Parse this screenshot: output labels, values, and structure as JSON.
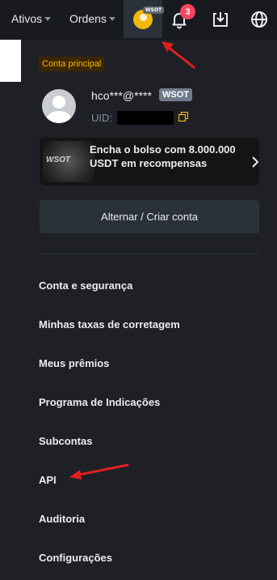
{
  "topnav": {
    "assets_label": "Ativos",
    "orders_label": "Ordens",
    "avatar_badge": "WSOT",
    "notification_count": "3"
  },
  "account": {
    "label": "Conta principal",
    "email": "hco***@****",
    "tag": "WSOT",
    "uid_label": "UID:"
  },
  "promo": {
    "logo_text": "WSOT",
    "text": "Encha o bolso com 8.000.000 USDT em recompensas"
  },
  "switch_button": "Alternar / Criar conta",
  "menu": [
    "Conta e segurança",
    "Minhas taxas de corretagem",
    "Meus prêmios",
    "Programa de Indicações",
    "Subcontas",
    "API",
    "Auditoria",
    "Configurações"
  ],
  "colors": {
    "accent": "#f0b90b",
    "annotation_arrow": "#e0201b",
    "notification": "#f6465d"
  }
}
